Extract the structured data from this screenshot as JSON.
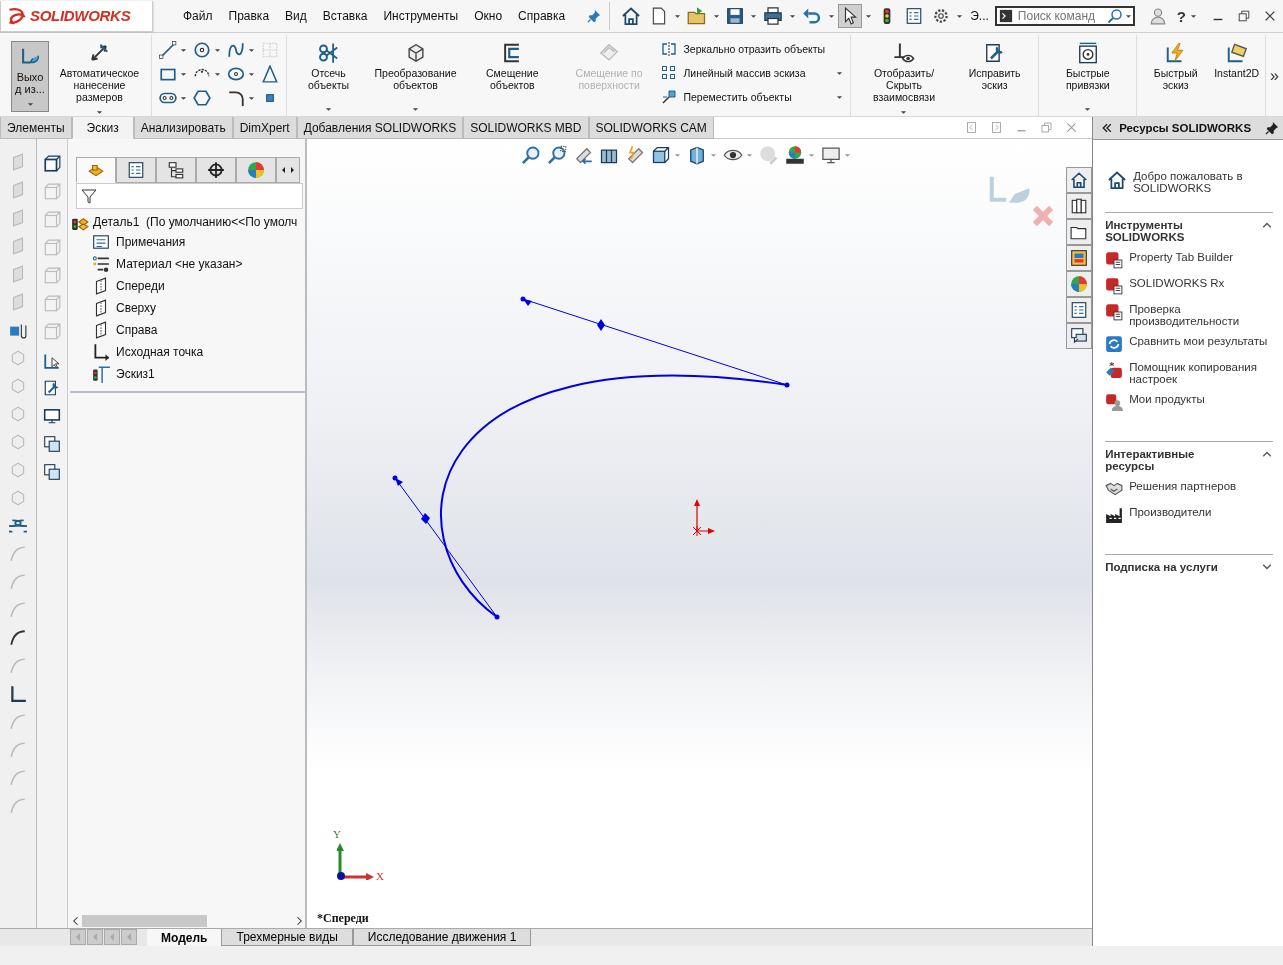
{
  "logo": {
    "text": "SOLIDWORKS"
  },
  "menu": [
    "Файл",
    "Правка",
    "Вид",
    "Вставка",
    "Инструменты",
    "Окно",
    "Справка"
  ],
  "quick_toolbar": {
    "select_selected": true,
    "overflow": "Э..."
  },
  "search": {
    "placeholder": "Поиск команд"
  },
  "help": "?",
  "ribbon": {
    "groups": [
      [
        {
          "kind": "exit",
          "label": "Выход из...",
          "selected": true,
          "dropdown": true
        },
        {
          "kind": "big",
          "label": "Автоматическое нанесение размеров",
          "dropdown": true,
          "disabled": false
        }
      ],
      [
        {
          "kind": "tools"
        }
      ],
      [
        {
          "kind": "big",
          "label": "Отсечь объекты",
          "dropdown": true,
          "disabled": false
        },
        {
          "kind": "big",
          "label": "Преобразование объектов",
          "dropdown": true,
          "disabled": false
        },
        {
          "kind": "big",
          "label": "Смещение объектов",
          "dropdown": false,
          "disabled": false
        },
        {
          "kind": "big",
          "label": "Смещение по поверхности",
          "dropdown": false,
          "disabled": true
        },
        {
          "kind": "list",
          "items": [
            {
              "label": "Зеркально отразить объекты",
              "dropdown": false
            },
            {
              "label": "Линейный массив эскиза",
              "dropdown": true
            },
            {
              "label": "Переместить объекты",
              "dropdown": true
            }
          ]
        }
      ],
      [
        {
          "kind": "big",
          "label": "Отобразить/Скрыть взаимосвязи",
          "dropdown": true,
          "disabled": false
        },
        {
          "kind": "big",
          "label": "Исправить эскиз",
          "dropdown": false,
          "disabled": false
        }
      ],
      [
        {
          "kind": "big",
          "label": "Быстрые привязки",
          "dropdown": true,
          "disabled": false
        }
      ],
      [
        {
          "kind": "big",
          "label": "Быстрый эскиз",
          "dropdown": false,
          "disabled": false
        },
        {
          "kind": "big",
          "label": "Instant2D",
          "dropdown": false,
          "disabled": false
        }
      ]
    ],
    "more": "»"
  },
  "command_tabs": [
    {
      "label": "Элементы",
      "selected": false
    },
    {
      "label": "Эскиз",
      "selected": true
    },
    {
      "label": "Анализировать",
      "selected": false
    },
    {
      "label": "DimXpert",
      "selected": false
    },
    {
      "label": "Добавления SOLIDWORKS",
      "selected": false
    },
    {
      "label": "SOLIDWORKS MBD",
      "selected": false
    },
    {
      "label": "SOLIDWORKS CAM",
      "selected": false
    }
  ],
  "tree_panel_tabs": [
    {
      "selected": true
    },
    {
      "selected": false
    },
    {
      "selected": false
    },
    {
      "selected": false
    },
    {
      "selected": false
    }
  ],
  "tree": {
    "root": {
      "label": "Деталь1  (По умолчанию<<По умолч",
      "children": [
        {
          "label": "Примечания",
          "kind": "annotations"
        },
        {
          "label": "Материал <не указан>",
          "kind": "material"
        },
        {
          "label": "Спереди",
          "kind": "plane"
        },
        {
          "label": "Сверху",
          "kind": "plane"
        },
        {
          "label": "Справа",
          "kind": "plane"
        },
        {
          "label": "Исходная точка",
          "kind": "origin"
        },
        {
          "label": "Эскиз1",
          "kind": "sketch"
        }
      ]
    }
  },
  "canvas": {
    "view_label": "*Спереди",
    "axis_y": "Y",
    "axis_x": "X"
  },
  "resources": {
    "title": "Ресурсы SOLIDWORKS",
    "welcome": "Добро пожаловать в SOLIDWORKS",
    "sections": [
      {
        "title": "Инструменты SOLIDWORKS",
        "expanded": true,
        "items": [
          {
            "label": "Property Tab Builder",
            "kind": "tool"
          },
          {
            "label": "SOLIDWORKS Rx",
            "kind": "tool"
          },
          {
            "label": "Проверка производительности",
            "kind": "tool"
          },
          {
            "label": "Сравнить мои результаты",
            "kind": "compare"
          },
          {
            "label": "Помощник копирования настроек",
            "kind": "copy"
          },
          {
            "label": "Мои продукты",
            "kind": "products"
          }
        ]
      },
      {
        "title": "Интерактивные ресурсы",
        "expanded": true,
        "items": [
          {
            "label": "Решения партнеров",
            "kind": "partners"
          },
          {
            "label": "Производители",
            "kind": "factory"
          }
        ]
      },
      {
        "title": "Подписка на услуги",
        "expanded": false
      }
    ]
  },
  "bottom_tabs": [
    {
      "label": "Модель",
      "selected": true
    },
    {
      "label": "Трехмерные виды",
      "selected": false
    },
    {
      "label": "Исследование движения 1",
      "selected": false
    }
  ]
}
